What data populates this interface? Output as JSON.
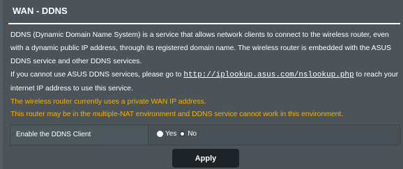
{
  "page": {
    "title": "WAN - DDNS"
  },
  "description": {
    "line1": "DDNS (Dynamic Domain Name System) is a service that allows network clients to connect to the wireless router, even with a dynamic public IP address, through its registered domain name. The wireless router is embedded with the ASUS DDNS service and other DDNS services.",
    "line2_prefix": "If you cannot use ASUS DDNS services, please go to ",
    "line2_link": "http://iplookup.asus.com/nslookup.php",
    "line2_suffix": " to reach your internet IP address to use this service."
  },
  "warnings": [
    "The wireless router currently uses a private WAN IP address.",
    "This router may be in the multiple-NAT environment and DDNS service cannot work in this environment."
  ],
  "settings": {
    "enable_ddns": {
      "label": "Enable the DDNS Client",
      "options": [
        {
          "label": "Yes",
          "selected": false
        },
        {
          "label": "No",
          "selected": true
        }
      ]
    }
  },
  "actions": {
    "apply_label": "Apply"
  },
  "colors": {
    "background": "#4c5459",
    "warning_text": "#f3b200",
    "button": "#1d2326"
  }
}
